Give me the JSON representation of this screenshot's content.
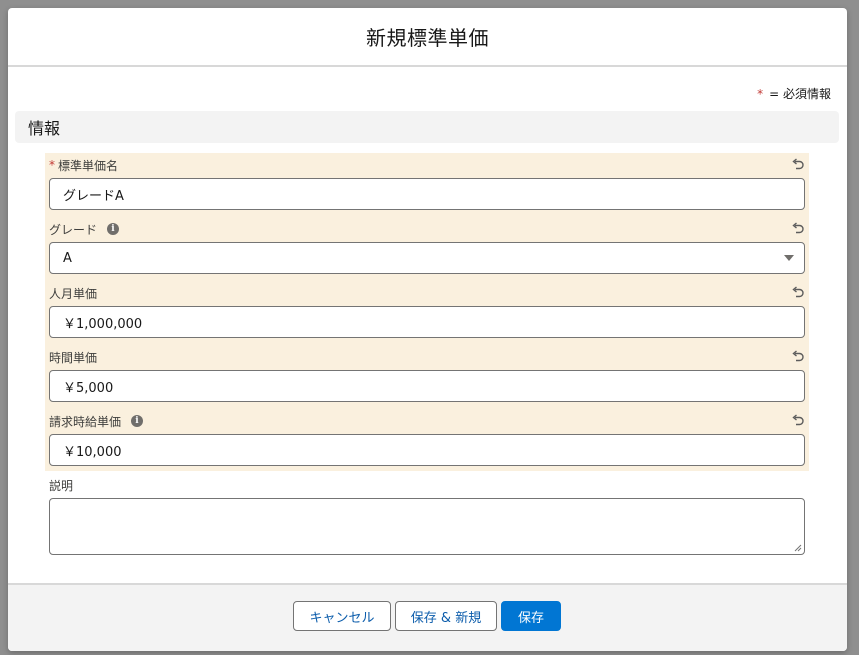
{
  "modal": {
    "title": "新規標準単価"
  },
  "legend": {
    "star": "*",
    "text": "= 必須情報"
  },
  "section": {
    "title": "情報"
  },
  "fields": {
    "name": {
      "required_mark": "*",
      "label": "標準単価名",
      "value": "グレードA"
    },
    "grade": {
      "label": "グレード",
      "value": "A"
    },
    "monthly_rate": {
      "label": "人月単価",
      "value": "￥1,000,000"
    },
    "hourly_rate": {
      "label": "時間単価",
      "value": "￥5,000"
    },
    "billing_rate": {
      "label": "請求時給単価",
      "value": "￥10,000"
    },
    "description": {
      "label": "説明",
      "value": ""
    }
  },
  "footer": {
    "cancel_label": "キャンセル",
    "save_new_label": "保存 & 新規",
    "save_label": "保存"
  },
  "colors": {
    "brand": "#0176d3",
    "edited_highlight": "#faf0de",
    "required": "#c23934"
  },
  "icons": {
    "undo": "undo-icon",
    "info": "info-icon",
    "select": "chevron-down-icon"
  }
}
